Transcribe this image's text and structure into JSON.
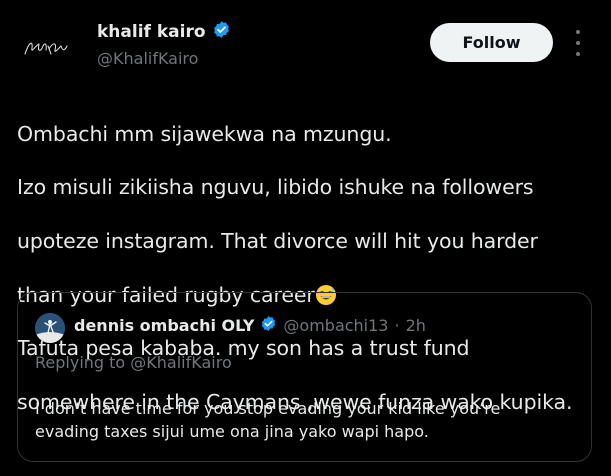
{
  "tweet": {
    "author": {
      "display_name": "khalif kairo",
      "handle": "@KhalifKairo",
      "verified": true,
      "avatar_signature": "Khalif Kairo"
    },
    "follow_label": "Follow",
    "more_icon": "more-vertical-icon",
    "text_lines": [
      "Ombachi mm sijawekwa na mzungu.",
      "Izo misuli zikiisha nguvu, libido ishuke na followers",
      "upoteze instagram. That divorce will hit you harder",
      "than your failed rugby career",
      "Tafuta pesa kababa. my son has a trust fund",
      "somewhere in the Caymans ,wewe funza wako kupika."
    ],
    "emoji": "grinning-face-with-sweat"
  },
  "quote": {
    "author": {
      "display_name": "dennis ombachi OLY",
      "handle": "@ombachi13",
      "separator": "·",
      "time": "2h",
      "verified": true
    },
    "replying_prefix": "Replying to",
    "replying_to": "@KhalifKairo",
    "text_lines": [
      "I don’t have time for you stop evading your kid like you’re",
      "evading taxes sijui ume ona jina yako wapi hapo."
    ]
  },
  "colors": {
    "background": "#000000",
    "text": "#e7e9ea",
    "secondary": "#71767b",
    "verified": "#1d9bf0",
    "follow_bg": "#eff3f4",
    "border": "#2f3336"
  }
}
